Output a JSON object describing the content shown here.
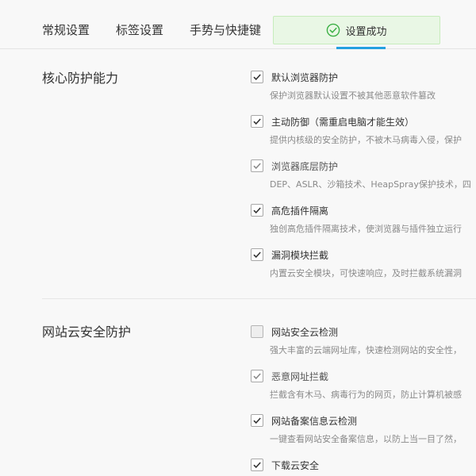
{
  "tabs": [
    {
      "label": "常规设置"
    },
    {
      "label": "标签设置"
    },
    {
      "label": "手势与快捷键"
    }
  ],
  "toast": {
    "text": "设置成功",
    "icon": "check-circle-icon",
    "color": "#3cb045"
  },
  "sections": [
    {
      "title": "核心防护能力",
      "options": [
        {
          "label": "默认浏览器防护",
          "desc": "保护浏览器默认设置不被其他恶意软件篡改",
          "checked": true
        },
        {
          "label": "主动防御（需重启电脑才能生效）",
          "desc": "提供内核级的安全防护，不被木马病毒入侵，保护",
          "checked": true
        },
        {
          "label": "浏览器底层防护",
          "desc": "DEP、ASLR、沙箱技术、HeapSpray保护技术，四",
          "checked": true,
          "disabled": true
        },
        {
          "label": "高危插件隔离",
          "desc": "独创高危插件隔离技术，使浏览器与插件独立运行",
          "checked": true
        },
        {
          "label": "漏洞模块拦截",
          "desc": "内置云安全模块，可快速响应，及时拦截系统漏洞",
          "checked": true
        }
      ]
    },
    {
      "title": "网站云安全防护",
      "options": [
        {
          "label": "网站安全云检测",
          "desc": "强大丰富的云端网址库，快速检测网站的安全性，",
          "checked": false
        },
        {
          "label": "恶意网址拦截",
          "desc": "拦截含有木马、病毒行为的网页，防止计算机被感",
          "checked": true,
          "disabled": true
        },
        {
          "label": "网站备案信息云检测",
          "desc": "一键查看网站安全备案信息，以防上当一目了然，",
          "checked": true
        },
        {
          "label": "下载云安全",
          "desc": "",
          "checked": true
        }
      ]
    }
  ],
  "colors": {
    "accent": "#24a0e0",
    "toast_bg": "#e9f7e5",
    "check": "#333333"
  }
}
